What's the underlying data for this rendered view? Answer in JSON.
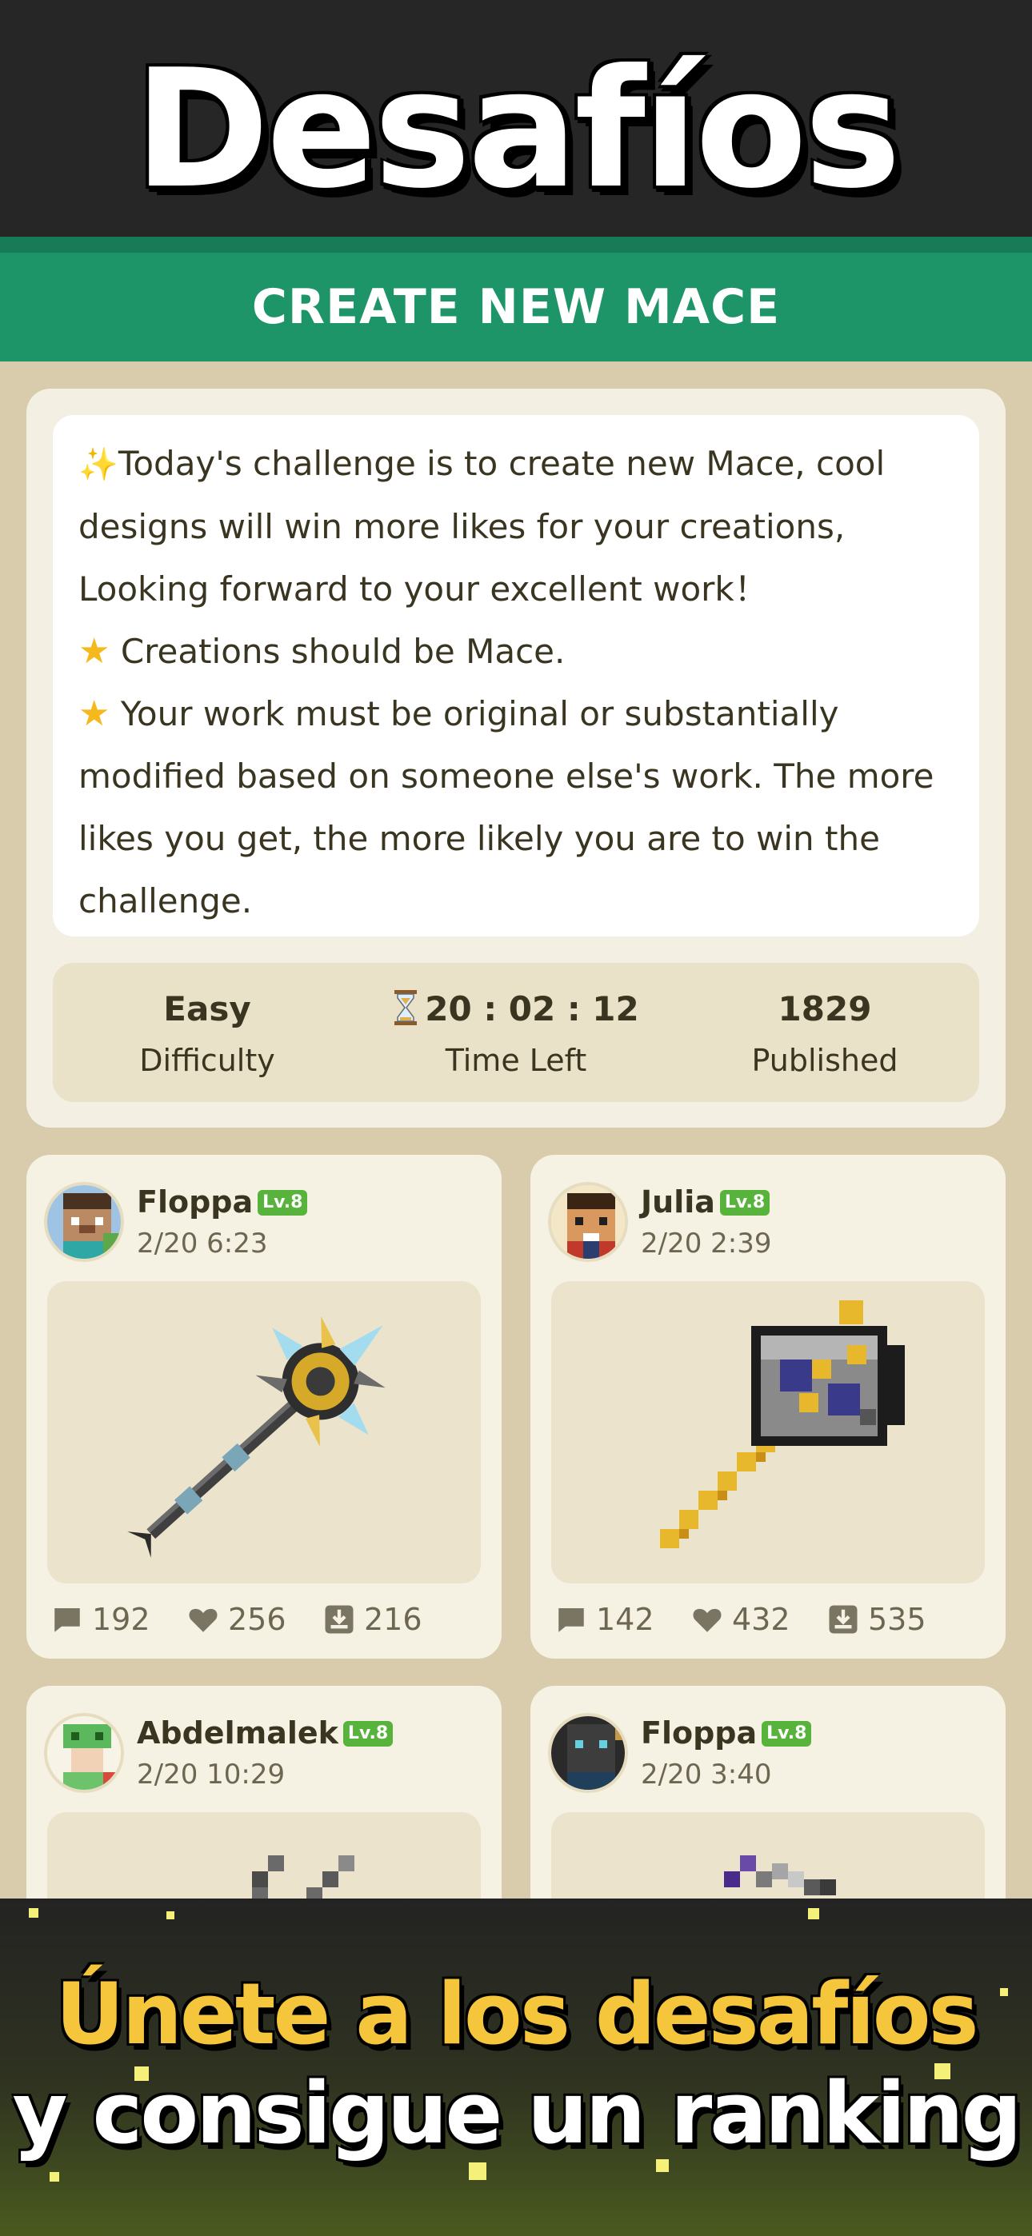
{
  "hero": {
    "title": "Desafíos"
  },
  "header": {
    "title": "CREATE NEW MACE"
  },
  "challenge": {
    "description_lines": [
      "Today's challenge is to create new Mace, cool",
      "designs will win more likes for your creations,",
      "Looking forward to your excellent work！",
      "Creations should be Mace.",
      "Your work must be original or substantially",
      "modified based on someone else's work. The more",
      "likes you get, the more likely you are to win the",
      "challenge."
    ],
    "stats": {
      "difficulty_value": "Easy",
      "difficulty_label": "Difficulty",
      "time_value": "20 : 02 : 12",
      "time_label": "Time Left",
      "published_value": "1829",
      "published_label": "Published"
    }
  },
  "posts": [
    {
      "username": "Floppa",
      "level": "Lv.8",
      "date": "2/20 6:23",
      "comments": "192",
      "likes": "256",
      "downloads": "216",
      "avatar_icon": "steve-avatar-icon",
      "artwork_icon": "spiked-mace-icon"
    },
    {
      "username": "Julia",
      "level": "Lv.8",
      "date": "2/20 2:39",
      "comments": "142",
      "likes": "432",
      "downloads": "535",
      "avatar_icon": "boy-avatar-icon",
      "artwork_icon": "pixel-mace-icon"
    },
    {
      "username": "Abdelmalek",
      "level": "Lv.8",
      "date": "2/20 10:29",
      "comments": "",
      "likes": "",
      "downloads": "",
      "avatar_icon": "creeper-girl-avatar-icon",
      "artwork_icon": "pixel-mace-partial-icon"
    },
    {
      "username": "Floppa",
      "level": "Lv.8",
      "date": "2/20 3:40",
      "comments": "",
      "likes": "",
      "downloads": "",
      "avatar_icon": "dark-skin-avatar-icon",
      "artwork_icon": "purple-mace-partial-icon"
    }
  ],
  "banner": {
    "line1": "Únete a los desafíos",
    "line2": "y consigue un ranking"
  },
  "colors": {
    "hero_bg": "#262626",
    "header_green": "#1e9469",
    "page_bg": "#d8ccac",
    "card_bg": "#f5f1e3",
    "accent_yellow": "#f5c53c",
    "level_green": "#57b33b"
  }
}
